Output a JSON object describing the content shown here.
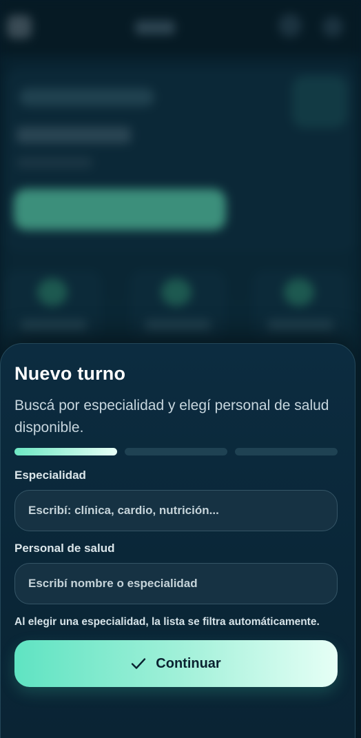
{
  "sheet": {
    "title": "Nuevo turno",
    "subtitle": "Buscá por especialidad y elegí personal de salud disponible.",
    "progress": {
      "current_step": 1,
      "total_steps": 3
    },
    "specialty": {
      "label": "Especialidad",
      "value": "",
      "placeholder": "Escribí: clínica, cardio, nutrición..."
    },
    "provider": {
      "label": "Personal de salud",
      "value": "",
      "placeholder": "Escribí nombre o especialidad"
    },
    "hint": "Al elegir una especialidad, la lista se filtra automáticamente.",
    "continue_button": {
      "label": "Continuar",
      "icon": "check-icon"
    }
  },
  "colors": {
    "accent": "#5fe3c2",
    "sheet_background": "#0b2a3c",
    "page_background": "#061a26"
  }
}
